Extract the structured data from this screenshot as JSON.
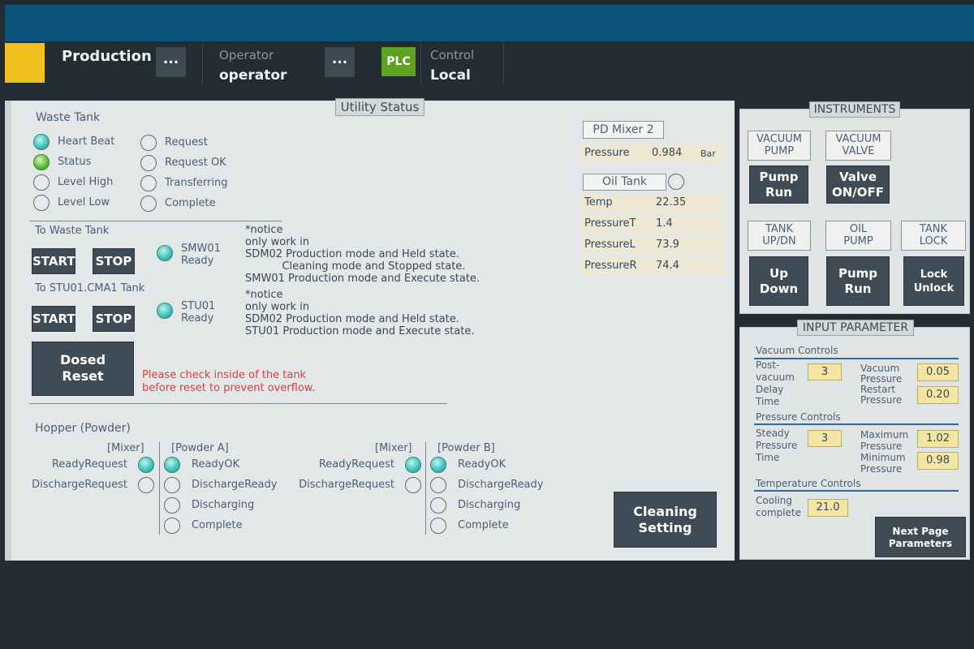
{
  "header": {
    "mode": "Production",
    "mode_more": "...",
    "operator_caption": "Operator",
    "operator_value": "operator",
    "operator_more": "...",
    "plc_badge": "PLC",
    "control_caption": "Control",
    "control_value": "Local"
  },
  "utility": {
    "title": "Utility Status",
    "waste_tank": {
      "title": "Waste Tank",
      "left_indicators": [
        {
          "label": "Heart Beat",
          "state": "cyan"
        },
        {
          "label": "Status",
          "state": "green"
        },
        {
          "label": "Level High",
          "state": "off"
        },
        {
          "label": "Level Low",
          "state": "off"
        }
      ],
      "right_indicators": [
        {
          "label": "Request",
          "state": "off"
        },
        {
          "label": "Request OK",
          "state": "off"
        },
        {
          "label": "Transferring",
          "state": "off"
        },
        {
          "label": "Complete",
          "state": "off"
        }
      ]
    },
    "to_waste_tank": {
      "title": "To Waste Tank",
      "start": "START",
      "stop": "STOP",
      "ready_label": "SMW01\nReady",
      "notice": "*notice\nonly work in\nSDM02 Production mode and Held state.\n           Cleaning mode and Stopped state.\nSMW01 Production mode and Execute state."
    },
    "to_stu01": {
      "title": "To STU01.CMA1 Tank",
      "start": "START",
      "stop": "STOP",
      "ready_label": "STU01\nReady",
      "notice": "*notice\nonly work in\nSDM02 Production mode and Held state.\nSTU01 Production mode and Execute state."
    },
    "dosed_reset": "Dosed\nReset",
    "warning": "Please check inside of the tank\nbefore reset to prevent overflow.",
    "hopper": {
      "title": "Hopper (Powder)",
      "a": {
        "mixer_header": "[Mixer]",
        "powder_header": "[Powder A]",
        "mixer_signals": [
          {
            "label": "ReadyRequest",
            "state": "cyan"
          },
          {
            "label": "DischargeRequest",
            "state": "off"
          }
        ],
        "powder_signals": [
          {
            "label": "ReadyOK",
            "state": "cyan"
          },
          {
            "label": "DischargeReady",
            "state": "off"
          },
          {
            "label": "Discharging",
            "state": "off"
          },
          {
            "label": "Complete",
            "state": "off"
          }
        ]
      },
      "b": {
        "mixer_header": "[Mixer]",
        "powder_header": "[Powder B]",
        "mixer_signals": [
          {
            "label": "ReadyRequest",
            "state": "cyan"
          },
          {
            "label": "DischargeRequest",
            "state": "off"
          }
        ],
        "powder_signals": [
          {
            "label": "ReadyOK",
            "state": "cyan"
          },
          {
            "label": "DischargeReady",
            "state": "off"
          },
          {
            "label": "Discharging",
            "state": "off"
          },
          {
            "label": "Complete",
            "state": "off"
          }
        ]
      }
    },
    "pd_mixer": {
      "title": "PD Mixer 2",
      "pressure_label": "Pressure",
      "pressure_value": "0.984",
      "pressure_unit": "Bar"
    },
    "oil_tank": {
      "title": "Oil Tank",
      "rows": [
        {
          "label": "Temp",
          "value": "22.35"
        },
        {
          "label": "PressureT",
          "value": "1.4"
        },
        {
          "label": "PressureL",
          "value": "73.9"
        },
        {
          "label": "PressureR",
          "value": "74.4"
        }
      ]
    },
    "cleaning_setting": "Cleaning\nSetting"
  },
  "instruments": {
    "title": "INSTRUMENTS",
    "vacuum_pump_label": "VACUUM\nPUMP",
    "vacuum_valve_label": "VACUUM\nVALVE",
    "pump_run": "Pump\nRun",
    "valve_onoff": "Valve\nON/OFF",
    "tank_updn_label": "TANK\nUP/DN",
    "oil_pump_label": "OIL\nPUMP",
    "tank_lock_label": "TANK\nLOCK",
    "up_down": "Up\nDown",
    "oil_pump_run": "Pump\nRun",
    "lock_unlock": "Lock\nUnlock"
  },
  "params": {
    "title": "INPUT PARAMETER",
    "vacuum_controls": "Vacuum Controls",
    "post_vacuum_label": "Post-\nvacuum\nDelay\nTime",
    "post_vacuum_value": "3",
    "vac_pressure_restart_label": "Vacuum\nPressure\nRestart\nPressure",
    "vac_pressure_value": "0.05",
    "restart_pressure_value": "0.20",
    "pressure_controls": "Pressure Controls",
    "steady_label": "Steady\nPressure\nTime",
    "steady_value": "3",
    "max_min_label": "Maximum\nPressure\nMinimum\nPressure",
    "max_value": "1.02",
    "min_value": "0.98",
    "temperature_controls": "Temperature Controls",
    "cooling_label": "Cooling\ncomplete",
    "cooling_value": "21.0",
    "next_page": "Next Page\nParameters"
  }
}
